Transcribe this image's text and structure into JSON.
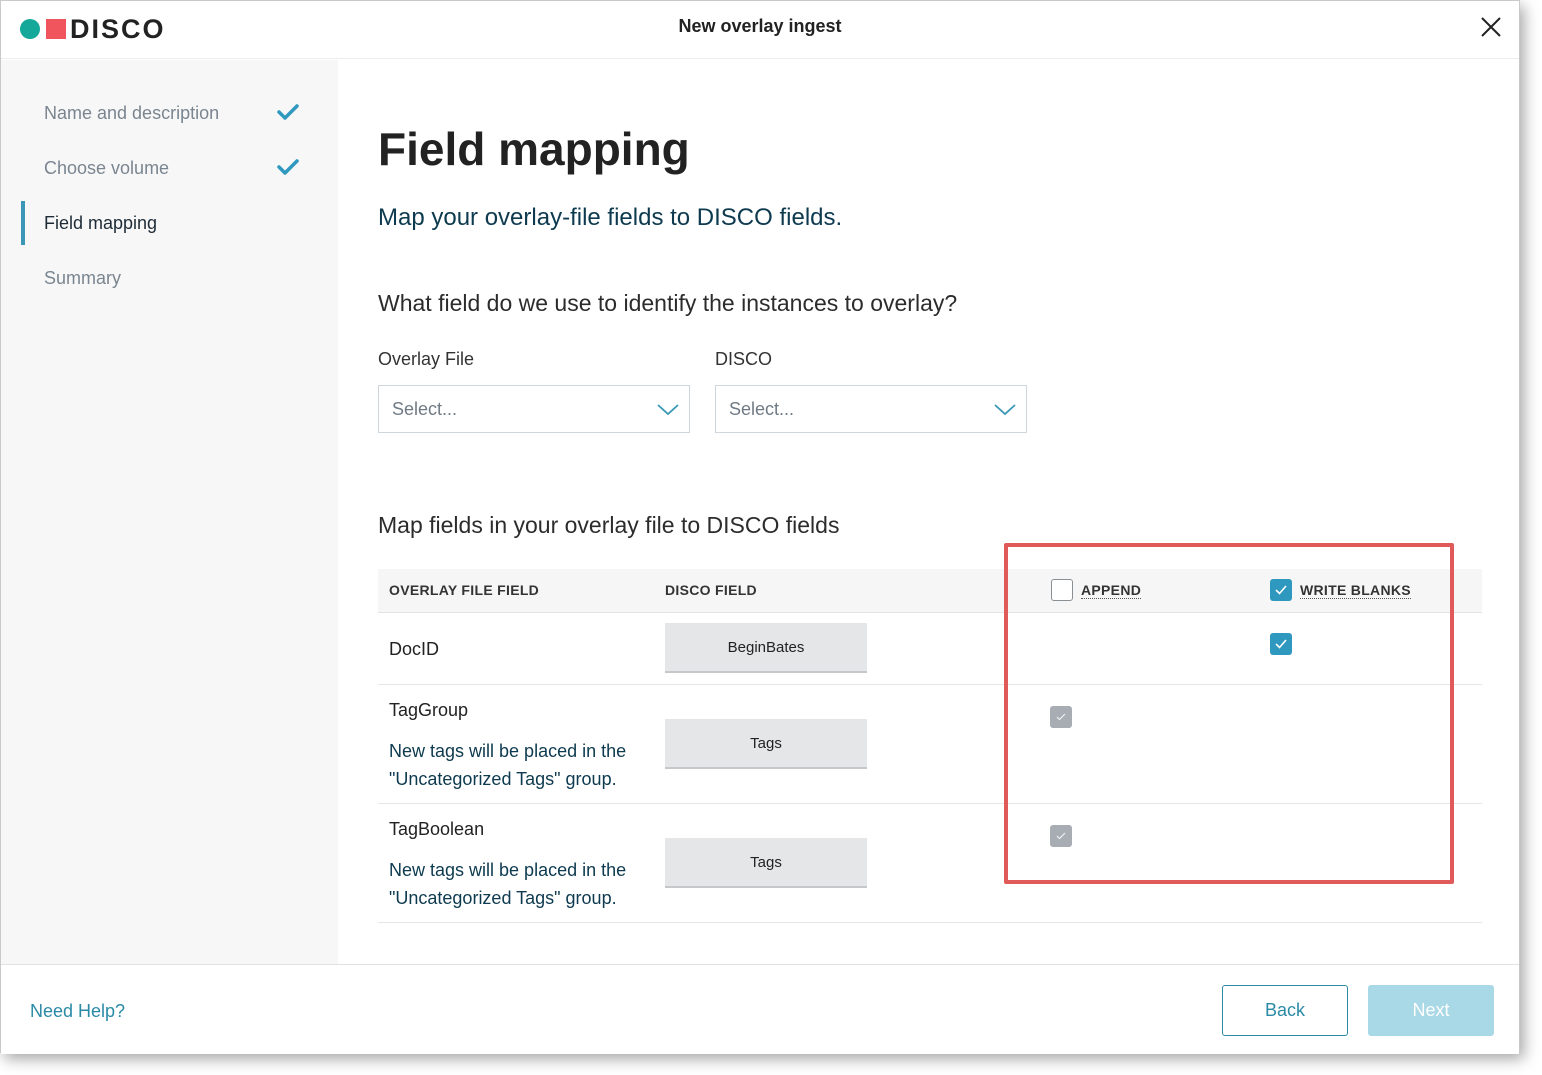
{
  "header": {
    "logo_text": "DISCO",
    "title": "New overlay ingest"
  },
  "sidebar": {
    "steps": [
      {
        "label": "Name and description",
        "state": "complete"
      },
      {
        "label": "Choose volume",
        "state": "complete"
      },
      {
        "label": "Field mapping",
        "state": "active"
      },
      {
        "label": "Summary",
        "state": "pending"
      }
    ]
  },
  "main": {
    "title": "Field mapping",
    "subtitle": "Map your overlay-file fields to DISCO fields.",
    "identify_question": "What field do we use to identify the instances to overlay?",
    "overlay_file_label": "Overlay File",
    "overlay_file_placeholder": "Select...",
    "disco_label": "DISCO",
    "disco_placeholder": "Select...",
    "map_section_title": "Map fields in your overlay file to DISCO fields"
  },
  "table": {
    "headers": {
      "overlay_field": "OVERLAY FILE FIELD",
      "disco_field": "DISCO FIELD",
      "append": "APPEND",
      "write_blanks": "WRITE BLANKS"
    },
    "header_checkboxes": {
      "append": false,
      "write_blanks": true
    },
    "rows": [
      {
        "overlay_field": "DocID",
        "note": "",
        "disco_field": "BeginBates",
        "append": null,
        "write_blanks": true
      },
      {
        "overlay_field": "TagGroup",
        "note": "New tags will be placed in the \"Uncategorized Tags\" group.",
        "disco_field": "Tags",
        "append": "checked-disabled",
        "write_blanks": null
      },
      {
        "overlay_field": "TagBoolean",
        "note": "New tags will be placed in the \"Uncategorized Tags\" group.",
        "disco_field": "Tags",
        "append": "checked-disabled",
        "write_blanks": null
      }
    ]
  },
  "footer": {
    "help_link": "Need Help?",
    "back_label": "Back",
    "next_label": "Next"
  },
  "colors": {
    "accent": "#2f98bf",
    "logo_teal": "#14a89b",
    "logo_red": "#f0545c",
    "highlight": "#e05a5a",
    "next_disabled": "#a9d8e6"
  },
  "icons": [
    "close-icon",
    "check-icon",
    "chevron-down-icon"
  ]
}
